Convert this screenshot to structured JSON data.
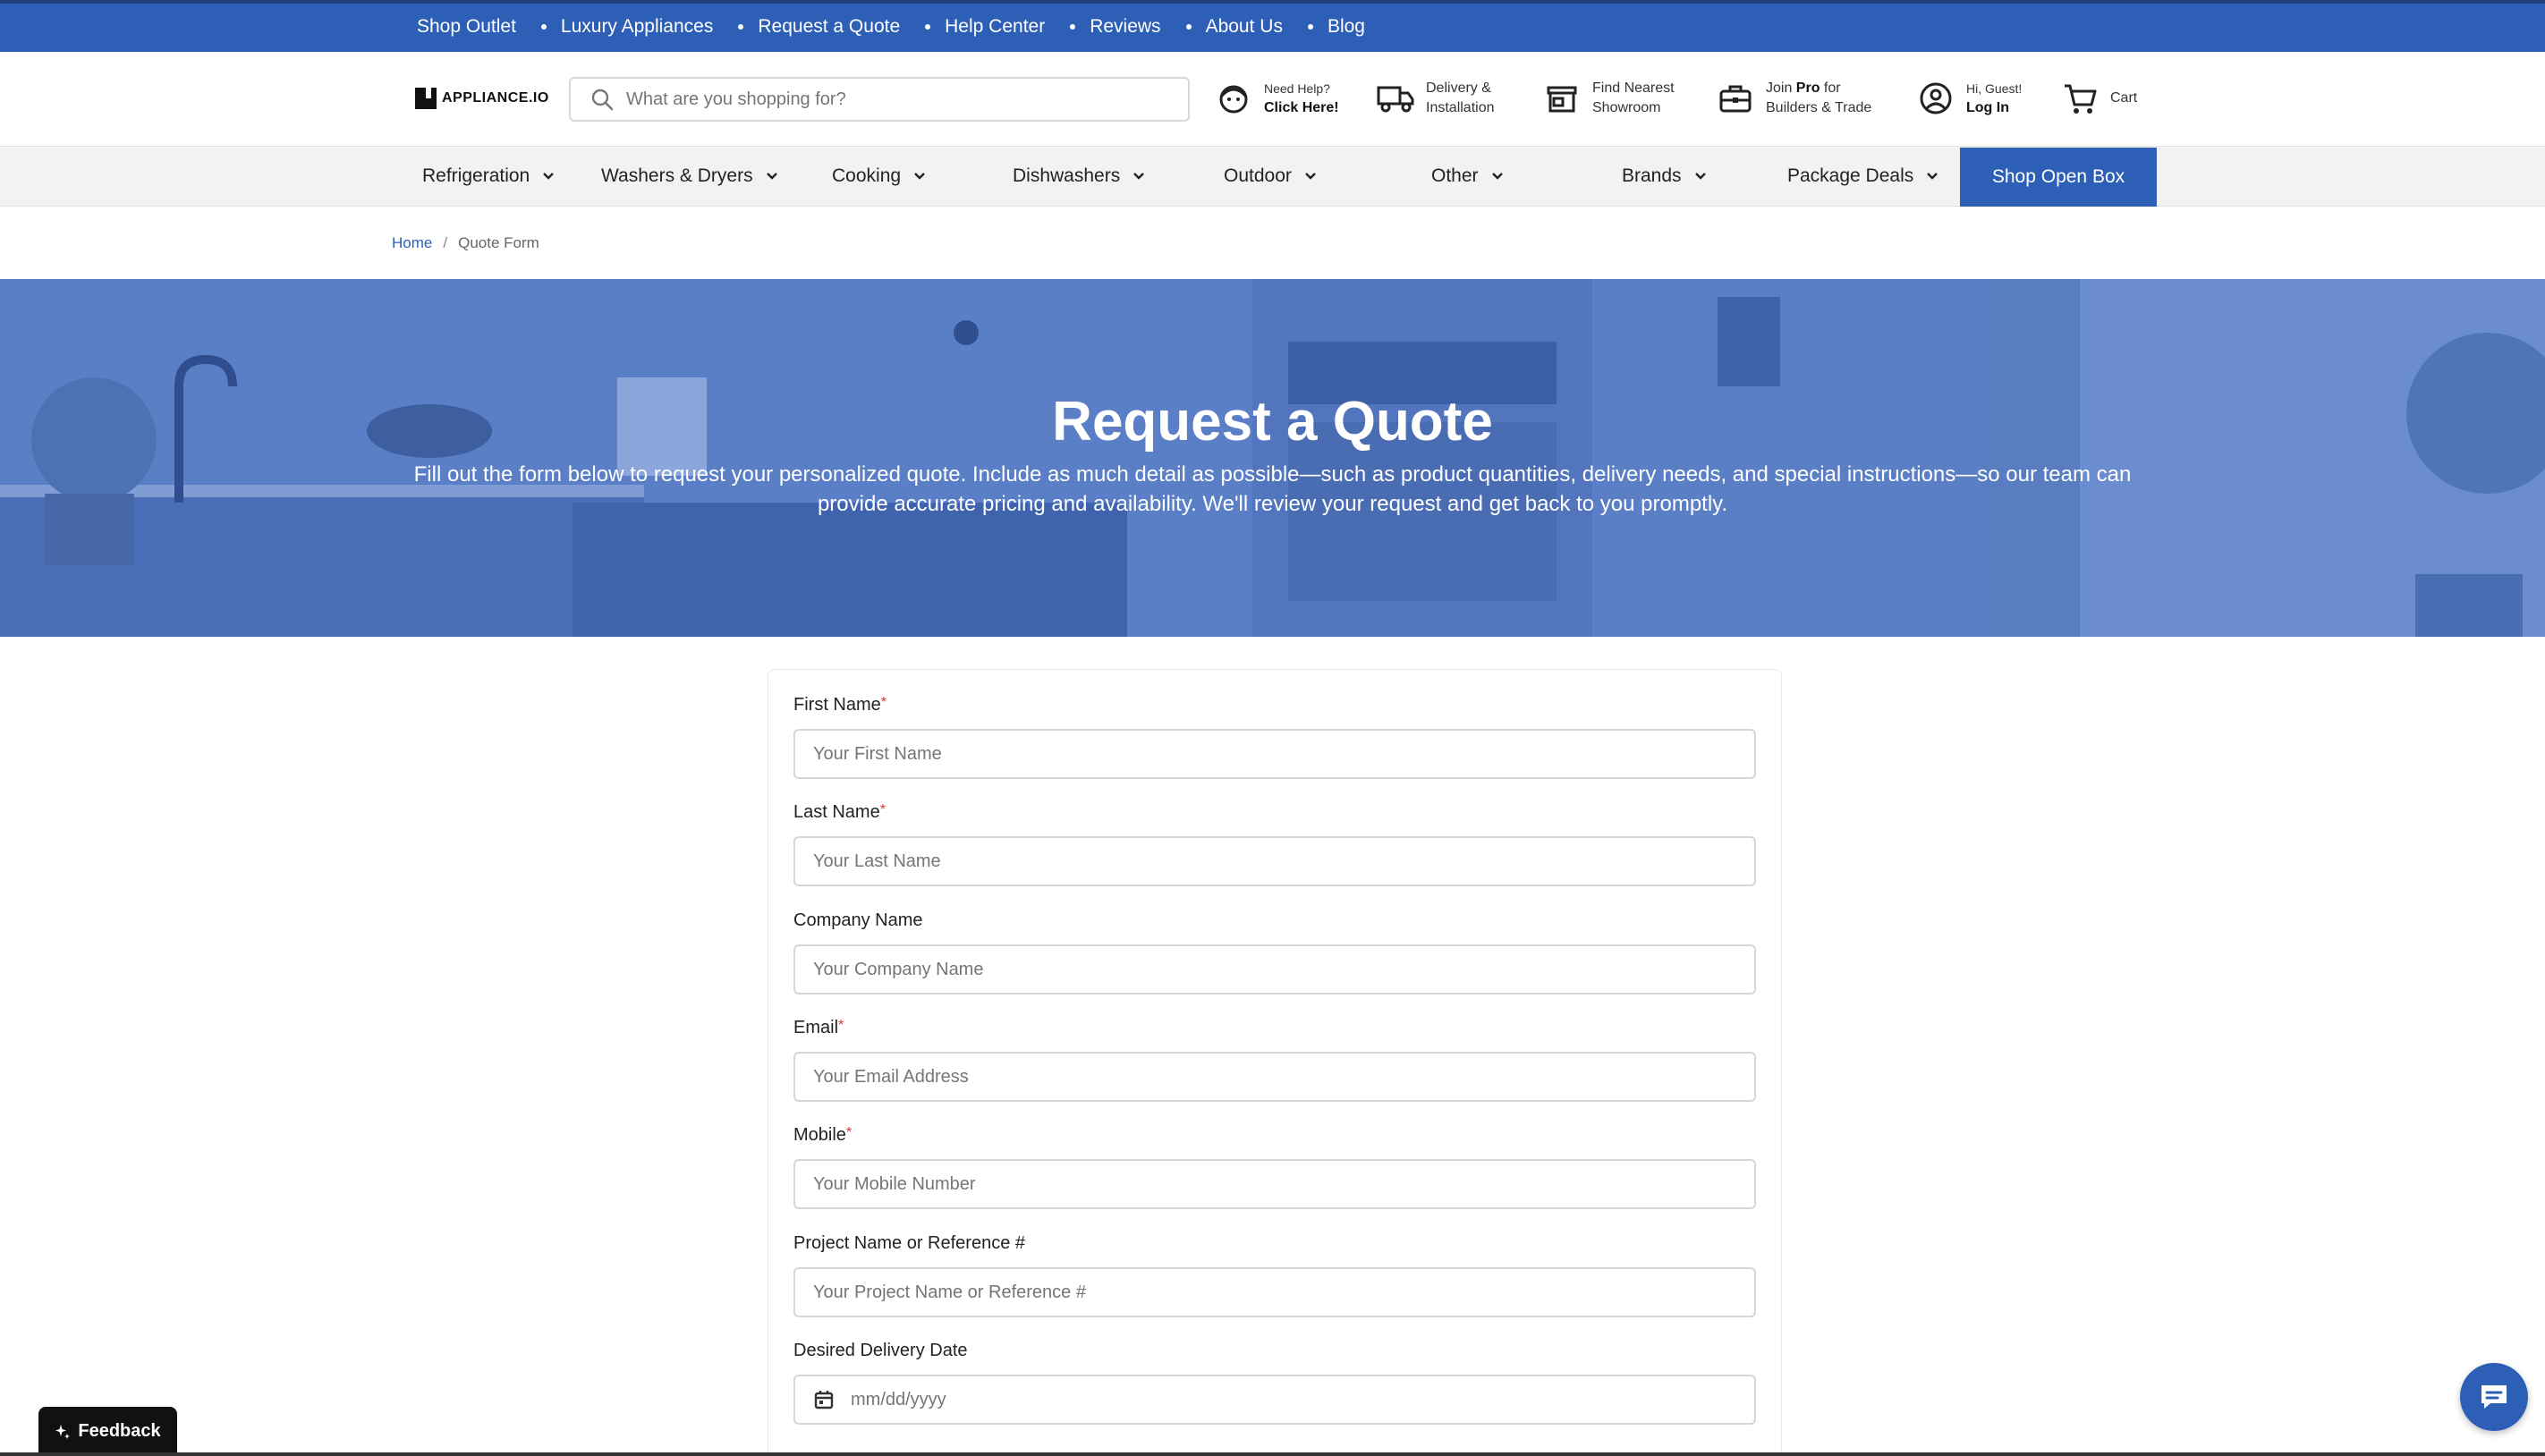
{
  "colors": {
    "brand_blue": "#2d5fb7",
    "required": "#e03030",
    "hero_overlay": "#5a7fc6"
  },
  "topbar": {
    "links": [
      "Shop Outlet",
      "Luxury Appliances",
      "Request a Quote",
      "Help Center",
      "Reviews",
      "About Us",
      "Blog"
    ]
  },
  "header": {
    "logo_text": "APPLIANCE.IO",
    "search_placeholder": "What are you shopping for?",
    "help_line1": "Need Help?",
    "help_line2": "Click Here!",
    "delivery_line1": "Delivery &",
    "delivery_line2": "Installation",
    "showroom_line1": "Find Nearest",
    "showroom_line2": "Showroom",
    "pro_pre": "Join ",
    "pro_bold": "Pro",
    "pro_post": " for",
    "pro_line2": "Builders & Trade",
    "account_line1": "Hi, Guest!",
    "account_line2": "Log In",
    "cart_label": "Cart"
  },
  "nav": {
    "items": [
      "Refrigeration",
      "Washers & Dryers",
      "Cooking",
      "Dishwashers",
      "Outdoor",
      "Other",
      "Brands",
      "Package Deals"
    ],
    "open_box": "Shop Open Box"
  },
  "breadcrumb": {
    "home": "Home",
    "sep": "/",
    "current": "Quote Form"
  },
  "hero": {
    "title": "Request a Quote",
    "text": "Fill out the form below to request your personalized quote. Include as much detail as possible—such as product quantities, delivery needs, and special instructions—so our team can provide accurate pricing and availability. We'll review your request and get back to you promptly."
  },
  "form": {
    "fields": [
      {
        "label": "First Name",
        "required": "*",
        "placeholder": "Your First Name"
      },
      {
        "label": "Last Name",
        "required": "*",
        "placeholder": "Your Last Name"
      },
      {
        "label": "Company Name",
        "required": "",
        "placeholder": "Your Company Name"
      },
      {
        "label": "Email",
        "required": "*",
        "placeholder": "Your Email Address"
      },
      {
        "label": "Mobile",
        "required": "*",
        "placeholder": "Your Mobile Number"
      },
      {
        "label": "Project Name or Reference #",
        "required": "",
        "placeholder": "Your Project Name or Reference #"
      },
      {
        "label": "Desired Delivery Date",
        "required": "",
        "placeholder": "mm/dd/yyyy"
      }
    ]
  },
  "feedback_label": "Feedback"
}
